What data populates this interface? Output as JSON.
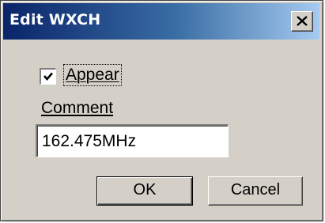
{
  "dialog": {
    "title": "Edit WXCH",
    "close_icon": "close-x-icon"
  },
  "appear": {
    "label": "Appear",
    "checked": true
  },
  "comment": {
    "label": "Comment",
    "value": "162.475MHz"
  },
  "buttons": {
    "ok_label": "OK",
    "cancel_label": "Cancel"
  },
  "colors": {
    "title_gradient_start": "#0a246a",
    "title_gradient_end": "#a6caf0",
    "face": "#d4d0c8"
  }
}
